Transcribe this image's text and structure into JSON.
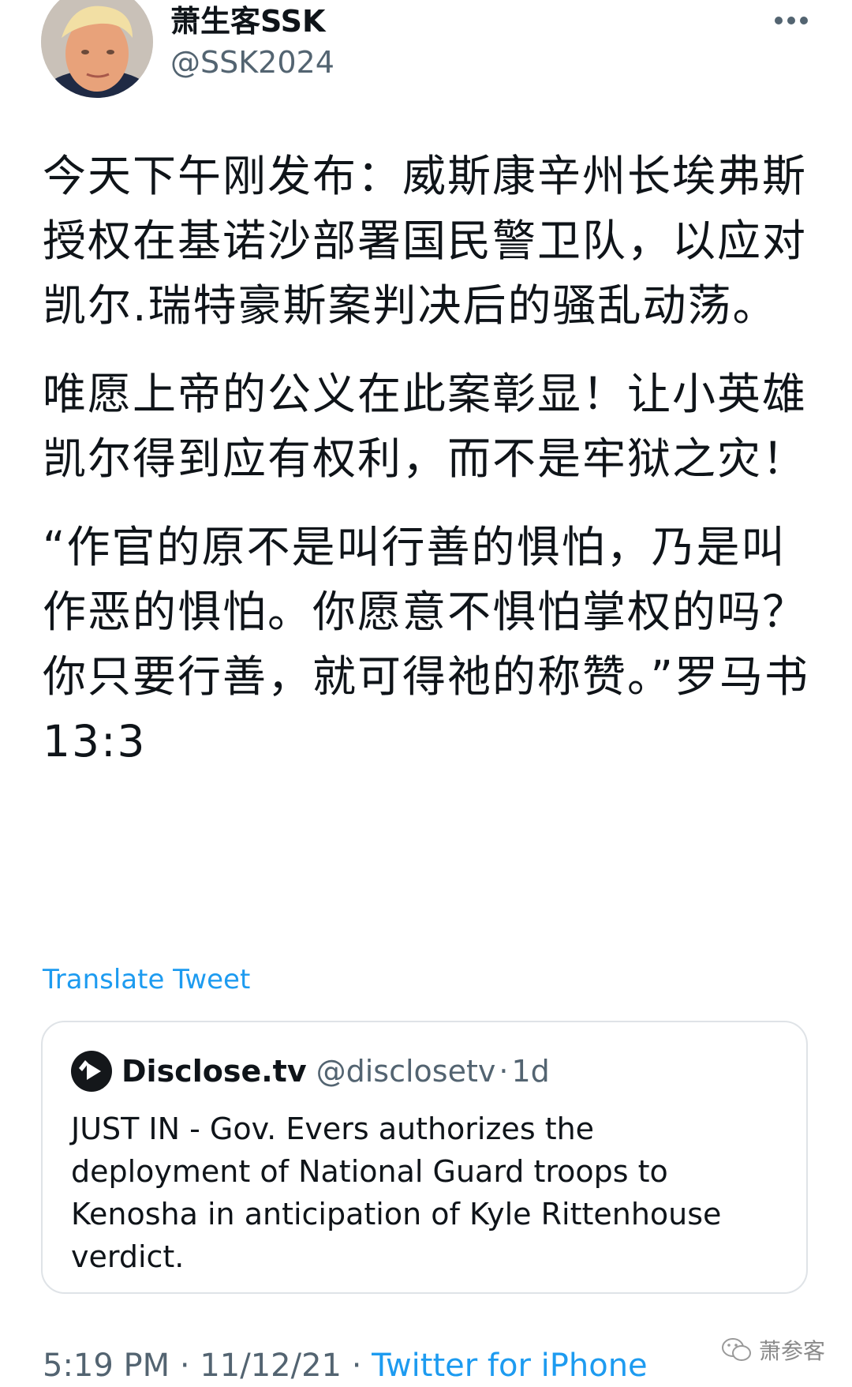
{
  "author": {
    "display_name": "萧生客SSK",
    "handle": "@SSK2024",
    "avatar_icon": "profile-photo"
  },
  "more_icon": "ellipsis-icon",
  "tweet": {
    "paragraphs": [
      "今天下午刚发布：威斯康辛州长埃弗斯授权在基诺沙部署国民警卫队，以应对凯尔.瑞特豪斯案判决后的骚乱动荡。",
      "唯愿上帝的公义在此案彰显！让小英雄凯尔得到应有权利，而不是牢狱之灾！",
      "“作官的原不是叫行善的惧怕，乃是叫作恶的惧怕。你愿意不惧怕掌权的吗？你只要行善，就可得祂的称赞。”罗马书 13:3"
    ],
    "translate_label": "Translate Tweet"
  },
  "quoted_tweet": {
    "logo_icon": "play-logo-icon",
    "name": "Disclose.tv",
    "handle": "@disclosetv",
    "separator": "·",
    "time": "1d",
    "text": "JUST IN - Gov. Evers authorizes the deployment of National Guard troops to Kenosha in anticipation of Kyle Rittenhouse verdict."
  },
  "meta": {
    "time": "5:19 PM",
    "separator": " · ",
    "date": "11/12/21",
    "source": "Twitter for iPhone"
  },
  "watermark": {
    "icon": "wechat-icon",
    "text": "萧参客"
  },
  "colors": {
    "link": "#1d9bf0",
    "secondary_text": "#536471",
    "primary_text": "#0f1419",
    "border": "#dfe3e7"
  }
}
